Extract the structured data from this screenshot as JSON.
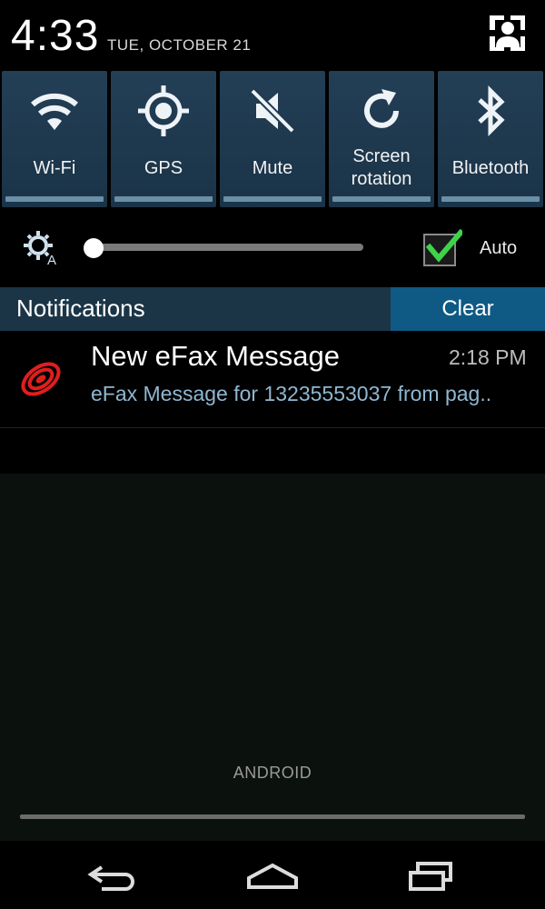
{
  "header": {
    "time": "4:33",
    "date": "TUE, OCTOBER 21"
  },
  "quick_settings": [
    {
      "label": "Wi-Fi",
      "icon": "wifi-icon"
    },
    {
      "label": "GPS",
      "icon": "gps-icon"
    },
    {
      "label": "Mute",
      "icon": "mute-icon"
    },
    {
      "label": "Screen\nrotation",
      "icon": "rotation-icon"
    },
    {
      "label": "Bluetooth",
      "icon": "bluetooth-icon"
    }
  ],
  "brightness": {
    "auto_label": "Auto",
    "auto_checked": true,
    "level": 0.0
  },
  "notifications": {
    "title": "Notifications",
    "clear_label": "Clear",
    "items": [
      {
        "title": "New eFax Message",
        "time": "2:18 PM",
        "body": "eFax Message for 13235553037 from  pag..",
        "icon": "efax-icon"
      }
    ]
  },
  "carrier": "ANDROID",
  "colors": {
    "tile_bg": "#1f3a50",
    "clear_bg": "#0e5a85",
    "notif_header_bg": "#1b3547",
    "check_green": "#3ed34a",
    "efax_red": "#e01e1e"
  }
}
